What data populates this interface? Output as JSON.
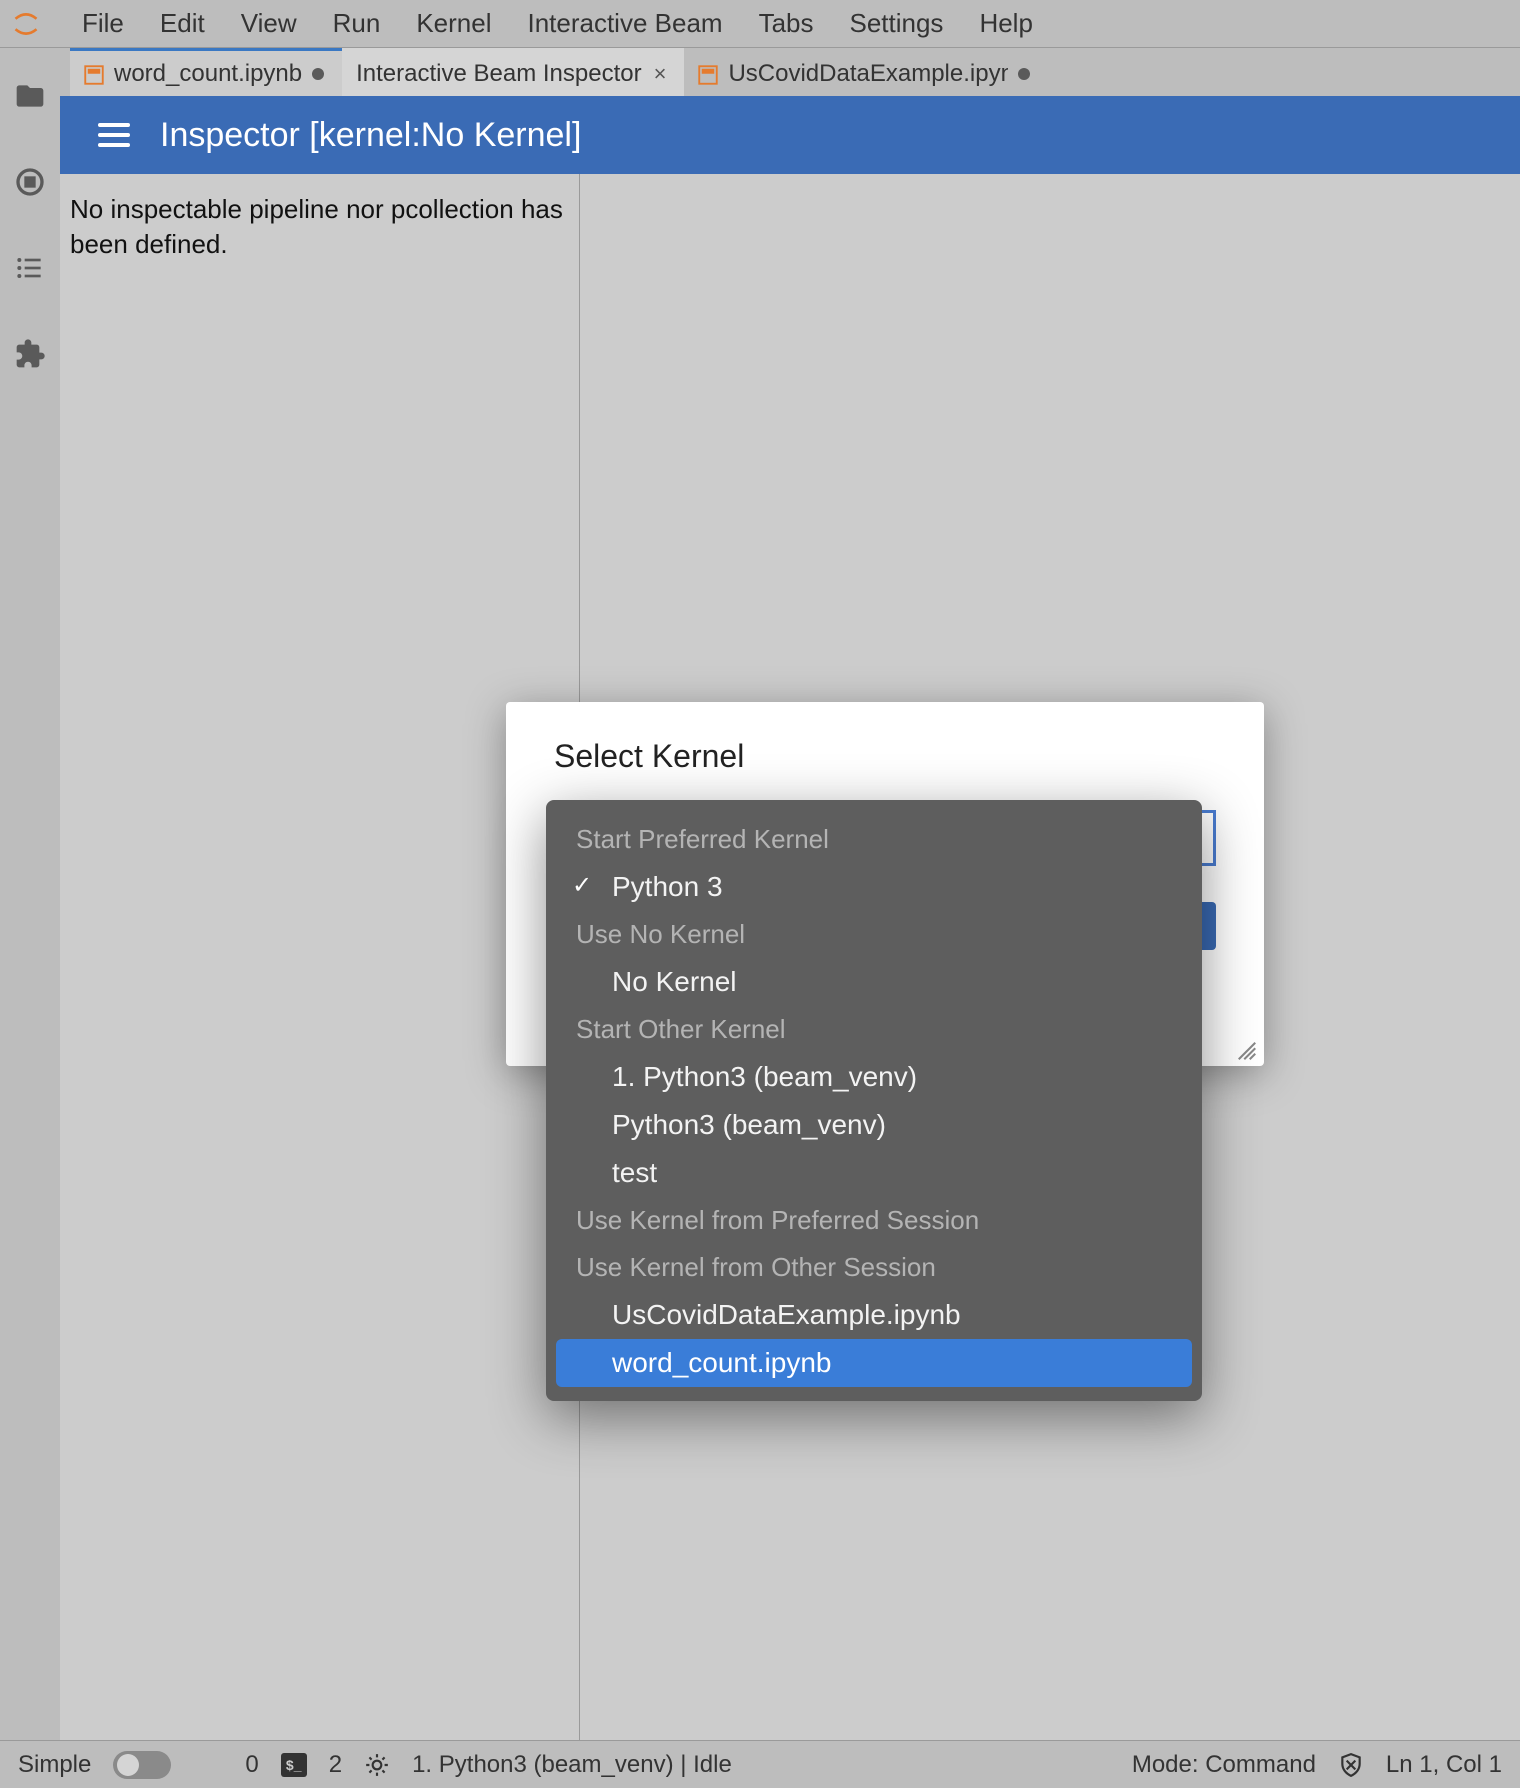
{
  "menubar": {
    "items": [
      "File",
      "Edit",
      "View",
      "Run",
      "Kernel",
      "Interactive Beam",
      "Tabs",
      "Settings",
      "Help"
    ]
  },
  "tabs": [
    {
      "label": "word_count.ipynb",
      "icon": "notebook-icon",
      "unsaved": true,
      "active": true
    },
    {
      "label": "Interactive Beam Inspector",
      "close": true,
      "current": true
    },
    {
      "label": "UsCovidDataExample.ipynb",
      "icon": "notebook-icon",
      "unsaved": true,
      "truncated": true
    }
  ],
  "inspector": {
    "title": "Inspector [kernel:No Kernel]",
    "left_panel_text": "No inspectable pipeline nor pcollection has been defined."
  },
  "dialog": {
    "title": "Select Kernel",
    "input_suffix": "\"",
    "groups": [
      {
        "label": "Start Preferred Kernel",
        "items": [
          {
            "label": "Python 3",
            "checked": true
          }
        ]
      },
      {
        "label": "Use No Kernel",
        "items": [
          {
            "label": "No Kernel"
          }
        ]
      },
      {
        "label": "Start Other Kernel",
        "items": [
          {
            "label": "1. Python3 (beam_venv)"
          },
          {
            "label": "Python3 (beam_venv)"
          },
          {
            "label": "test"
          }
        ]
      },
      {
        "label": "Use Kernel from Preferred Session",
        "items": []
      },
      {
        "label": "Use Kernel from Other Session",
        "items": [
          {
            "label": "UsCovidDataExample.ipynb"
          },
          {
            "label": "word_count.ipynb",
            "selected": true
          }
        ]
      }
    ]
  },
  "statusbar": {
    "simple_label": "Simple",
    "counter0": "0",
    "counter1": "2",
    "kernel_label": "1. Python3 (beam_venv) | Idle",
    "mode_label": "Mode: Command",
    "cursor_label": "Ln 1, Col 1"
  }
}
